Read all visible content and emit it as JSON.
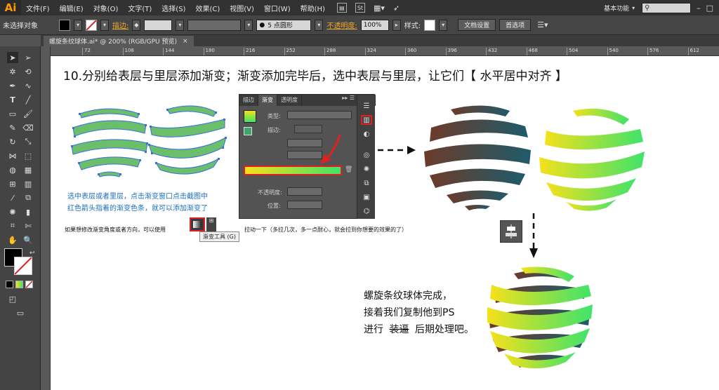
{
  "app": {
    "logo": "Ai",
    "menu": [
      "文件(F)",
      "编辑(E)",
      "对象(O)",
      "文字(T)",
      "选择(S)",
      "效果(C)",
      "视图(V)",
      "窗口(W)",
      "帮助(H)"
    ],
    "workspace": "基本功能",
    "search_icon": "search-icon",
    "window_controls": [
      "–",
      "□"
    ]
  },
  "control_bar": {
    "selection_label": "未选择对象",
    "stroke_label": "描边:",
    "brush_label": "5 点圆形",
    "opacity_label": "不透明度:",
    "opacity_value": "100%",
    "style_label": "样式:",
    "doc_setup_button": "文档设置",
    "preferences_button": "首选项"
  },
  "document": {
    "tab_title": "螺旋条纹球体.ai* @ 200% (RGB/GPU 预览)",
    "close_glyph": "×",
    "ruler_ticks": [
      "72",
      "108",
      "144",
      "180",
      "216",
      "252",
      "288",
      "324",
      "360",
      "396",
      "432",
      "468",
      "504",
      "540",
      "576",
      "612"
    ]
  },
  "canvas": {
    "heading": "10.分别给表层与里层添加渐变；渐变添加完毕后，选中表层与里层，让它们【 水平居中对齐 】",
    "note_line1": "选中表层或者里层，点击渐变窗口点击截图中",
    "note_line2": "红色箭头指着的渐变色条，就可以添加渐变了",
    "tip_before": "如果想修改渐变角度或者方向，可以使用",
    "tip_after": "拉动一下（多拉几次，多一点耐心，就会拉到你想要的效果的了）",
    "tooltip": "渐变工具 (G)",
    "final_line1": "螺旋条纹球体完成，",
    "final_line2": "接着我们复制他到PS",
    "final_line3_pre": "进行",
    "final_line3_strike": "装逼",
    "final_line3_post": "后期处理吧。"
  },
  "gradient_panel": {
    "tabs": [
      "描边",
      "渐变",
      "透明度"
    ],
    "type_label": "类型:",
    "stroke_label": "描边:",
    "opacity_label": "不透明度:",
    "position_label": "位置:"
  },
  "colors": {
    "accent_red": "#e02020",
    "brown": "#6b3b2a",
    "teal": "#1f5b6a",
    "yellow": "#f5e11a",
    "green": "#3fe36a",
    "stripe_green": "#6bbf6b",
    "anchor_blue": "#3a6fe0"
  }
}
